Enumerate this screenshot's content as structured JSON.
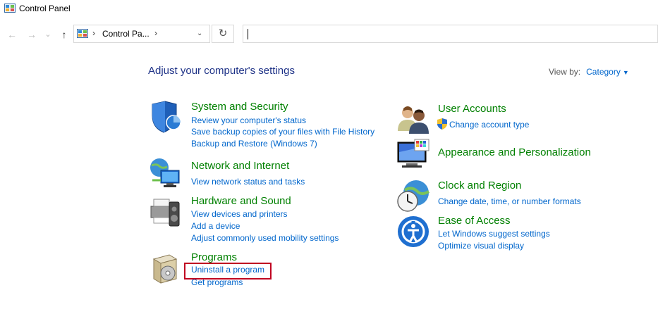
{
  "window": {
    "title": "Control Panel"
  },
  "address": {
    "crumb": "Control Pa...",
    "sep1": "›",
    "sep2": "›",
    "dropdown": "⌄",
    "refresh": "↻"
  },
  "nav": {
    "back": "←",
    "forward": "→",
    "recent": "⌄",
    "up": "↑"
  },
  "main": {
    "heading": "Adjust your computer's settings",
    "view_by": {
      "label": "View by:",
      "value": "Category",
      "caret": "▼"
    }
  },
  "categories": {
    "system_security": {
      "title": "System and Security",
      "links": [
        "Review your computer's status",
        "Save backup copies of your files with File History",
        "Backup and Restore (Windows 7)"
      ]
    },
    "network": {
      "title": "Network and Internet",
      "links": [
        "View network status and tasks"
      ]
    },
    "hardware": {
      "title": "Hardware and Sound",
      "links": [
        "View devices and printers",
        "Add a device",
        "Adjust commonly used mobility settings"
      ]
    },
    "programs": {
      "title": "Programs",
      "links": [
        "Uninstall a program",
        "Get programs"
      ]
    },
    "user_accounts": {
      "title": "User Accounts",
      "links": [
        "Change account type"
      ]
    },
    "appearance": {
      "title": "Appearance and Personalization",
      "links": []
    },
    "clock": {
      "title": "Clock and Region",
      "links": [
        "Change date, time, or number formats"
      ]
    },
    "ease": {
      "title": "Ease of Access",
      "links": [
        "Let Windows suggest settings",
        "Optimize visual display"
      ]
    }
  },
  "colors": {
    "link": "#0066cc",
    "category_title": "#008000",
    "heading": "#1e3287",
    "highlight": "#c00020"
  }
}
